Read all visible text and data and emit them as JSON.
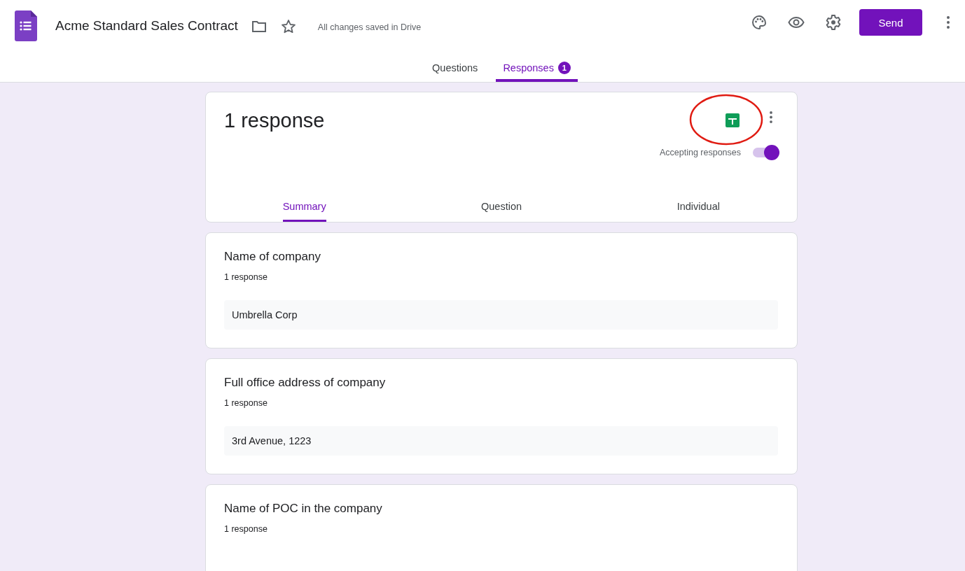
{
  "header": {
    "title": "Acme Standard Sales Contract",
    "save_status": "All changes saved in Drive",
    "send_button": "Send"
  },
  "tabs": [
    {
      "label": "Questions",
      "selected": false
    },
    {
      "label": "Responses",
      "selected": true,
      "badge": "1"
    }
  ],
  "summary_card": {
    "heading": "1 response",
    "sheets_highlighted": true,
    "accepting_label": "Accepting responses",
    "accepting_on": true,
    "subtabs": [
      {
        "label": "Summary",
        "selected": true
      },
      {
        "label": "Question",
        "selected": false
      },
      {
        "label": "Individual",
        "selected": false
      }
    ]
  },
  "questions": [
    {
      "title": "Name of company",
      "count": "1 response",
      "answers": [
        "Umbrella Corp"
      ]
    },
    {
      "title": "Full office address of company",
      "count": "1 response",
      "answers": [
        "3rd Avenue, 1223"
      ]
    },
    {
      "title": "Name of POC in the company",
      "count": "1 response"
    }
  ]
}
